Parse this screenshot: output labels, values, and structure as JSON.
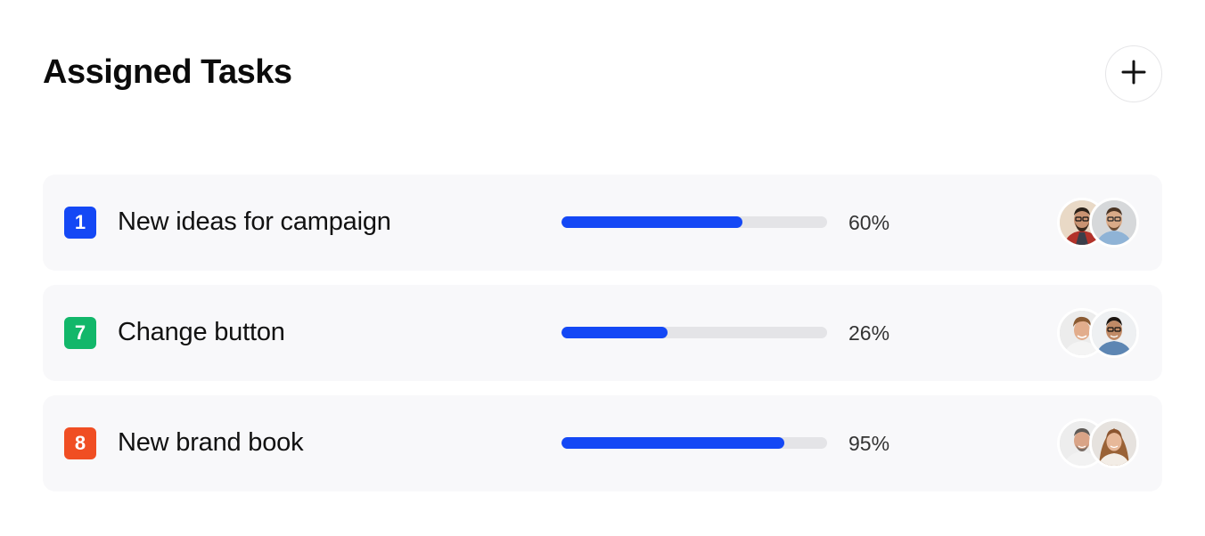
{
  "header": {
    "title": "Assigned Tasks",
    "add_icon": "plus-icon"
  },
  "colors": {
    "accent": "#1448f5",
    "track": "#e4e4e7",
    "row_bg": "#f8f8fa"
  },
  "tasks": [
    {
      "number": "1",
      "name": "New ideas for campaign",
      "progress": 0.68,
      "percent_label": "60%",
      "badge_color": "#1448f5",
      "assignees": [
        "avatar-man-beard-glasses",
        "avatar-man-glasses-denim"
      ]
    },
    {
      "number": "7",
      "name": "Change button",
      "progress": 0.4,
      "percent_label": "26%",
      "badge_color": "#12b76a",
      "assignees": [
        "avatar-man-smiling",
        "avatar-man-glasses-blue-shirt"
      ]
    },
    {
      "number": "8",
      "name": "New brand book",
      "progress": 0.84,
      "percent_label": "95%",
      "badge_color": "#f04e23",
      "assignees": [
        "avatar-man-grey-hair",
        "avatar-woman-curly-hair"
      ]
    }
  ]
}
